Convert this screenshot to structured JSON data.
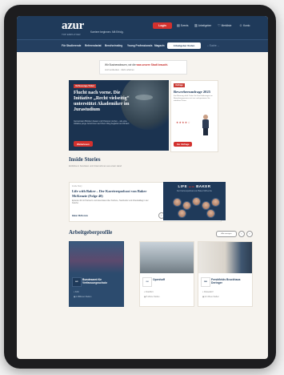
{
  "header": {
    "logo": "azur",
    "logo_sub": "TOP EMPLOYER",
    "tagline": "Karriere beginnen. Mit Erfolg.",
    "pill_label": "Login",
    "links": [
      {
        "icon": "document-icon",
        "label": "Events"
      },
      {
        "icon": "building-icon",
        "label": "Arbeitgeber"
      },
      {
        "icon": "heart-icon",
        "label": "Merkliste"
      },
      {
        "icon": "user-icon",
        "label": "Konto"
      }
    ]
  },
  "nav": {
    "items": [
      "Für Studierende",
      "Referendariat",
      "Berufseinstieg",
      "Young Professionals",
      "Magazin"
    ],
    "button": "Arbeitgeber finden",
    "search_placeholder": "Suche ..."
  },
  "ad": {
    "line1_pre": "Wir Businessfrauen, wir die",
    "line1_accent": "was unsere Stadt braucht.",
    "line2": "Jetzt entdecken · Mehr erfahren"
  },
  "hero": {
    "badge": "Verfassungs-Ticket",
    "title": "Flucht nach vorne. Die Initiative „Recht vielseitig“ unterstützt Akademiker im Jurastudium",
    "text": "Gemeinsam Brücken bauen und Chancen nutzen – wie eine Initiative junge Jurist:innen auf ihrem Weg begleitet und fördert.",
    "button": "Weiterlesen"
  },
  "sidebar_card": {
    "badge": "Umfrage",
    "title": "Bewerberumfrage 2025",
    "text": "Ihre Meinung zählt: Teilen Sie Ihre Erfahrungen im Bewerbungsprozess mit uns und gewinnen Sie attraktive Preise.",
    "stars": "★★★★☆",
    "button": "Zur Umfrage"
  },
  "inside_stories": {
    "title": "Inside Stories",
    "subtitle": "Einblicke in Kanzleien und Unternehmen aus erster Hand",
    "story": {
      "label": "Inside Story",
      "title": "Life with Baker – Der Karrierepodcast von Baker McKenzie (Folge 40)",
      "text": "Episode 40 mit Partnerin und Associates über Karriere, Teamkultur und Arbeitsalltag in der Kanzlei.",
      "author": "Baker McKenzie"
    },
    "podcast": {
      "title_pre": "LIFE",
      "title_mid": "with",
      "title_post": "BAKER",
      "subtitle": "Der Karrierepodcast von Baker McKenzie"
    }
  },
  "employers": {
    "title": "Arbeitgeberprofile",
    "all_button": "Alle anzeigen",
    "cards": [
      {
        "name": "Bundesamt für Verfassungsschutz",
        "logo": "BfV",
        "meta1": "Köln",
        "meta2": "1 Millionen Stellen"
      },
      {
        "name": "Openhoff",
        "logo": "OH",
        "meta1": "Frankfurt",
        "meta2": "5 offene Stellen"
      },
      {
        "name": "Freshfields Bruckhaus Deringer",
        "logo": "FBD",
        "meta1": "Düsseldorf",
        "meta2": "12 offene Stellen"
      }
    ]
  },
  "colors": {
    "header_bg": "#1f3a5a",
    "accent_red": "#d3312e",
    "page_bg": "#f6f3ee"
  }
}
